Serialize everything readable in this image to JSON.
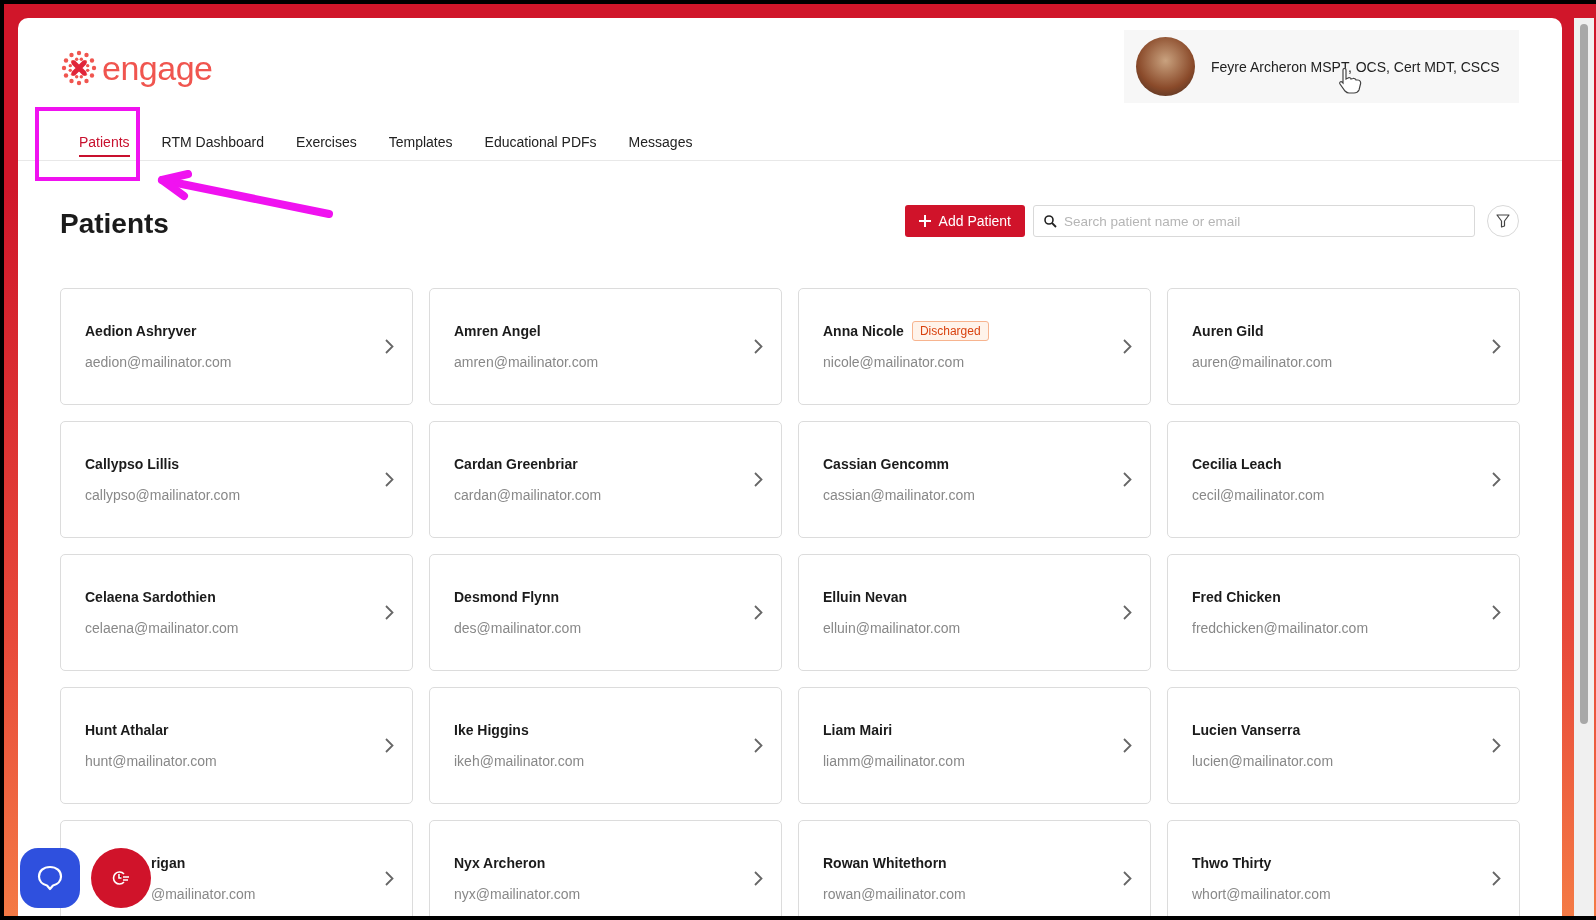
{
  "logo": {
    "text": "engage"
  },
  "user": {
    "name": "Feyre Archeron MSPT, OCS, Cert MDT, CSCS"
  },
  "tabs": [
    {
      "label": "Patients",
      "selected": true
    },
    {
      "label": "RTM Dashboard",
      "selected": false
    },
    {
      "label": "Exercises",
      "selected": false
    },
    {
      "label": "Templates",
      "selected": false
    },
    {
      "label": "Educational PDFs",
      "selected": false
    },
    {
      "label": "Messages",
      "selected": false
    }
  ],
  "page_title": "Patients",
  "add_button": {
    "label": "Add Patient"
  },
  "search": {
    "placeholder": "Search patient name or email"
  },
  "patients": [
    {
      "kind": "full",
      "name": "Aedion Ashryver",
      "email": "aedion@mailinator.com"
    },
    {
      "kind": "full",
      "name": "Amren Angel",
      "email": "amren@mailinator.com"
    },
    {
      "kind": "full",
      "name": "Anna Nicole",
      "email": "nicole@mailinator.com",
      "badge": "Discharged"
    },
    {
      "kind": "full",
      "name": "Auren Gild",
      "email": "auren@mailinator.com"
    },
    {
      "kind": "full",
      "name": "Callypso Lillis",
      "email": "callypso@mailinator.com"
    },
    {
      "kind": "full",
      "name": "Cardan Greenbriar",
      "email": "cardan@mailinator.com"
    },
    {
      "kind": "full",
      "name": "Cassian Gencomm",
      "email": "cassian@mailinator.com"
    },
    {
      "kind": "full",
      "name": "Cecilia Leach",
      "email": "cecil@mailinator.com"
    },
    {
      "kind": "full",
      "name": "Celaena Sardothien",
      "email": "celaena@mailinator.com"
    },
    {
      "kind": "full",
      "name": "Desmond Flynn",
      "email": "des@mailinator.com"
    },
    {
      "kind": "full",
      "name": "Elluin Nevan",
      "email": "elluin@mailinator.com"
    },
    {
      "kind": "full",
      "name": "Fred Chicken",
      "email": "fredchicken@mailinator.com"
    },
    {
      "kind": "full",
      "name": "Hunt Athalar",
      "email": "hunt@mailinator.com"
    },
    {
      "kind": "full",
      "name": "Ike Higgins",
      "email": "ikeh@mailinator.com"
    },
    {
      "kind": "full",
      "name": "Liam Mairi",
      "email": "liamm@mailinator.com"
    },
    {
      "kind": "full",
      "name": "Lucien Vanserra",
      "email": "lucien@mailinator.com"
    },
    {
      "kind": "partial",
      "name": "rigan",
      "email": "@mailinator.com"
    },
    {
      "kind": "full",
      "name": "Nyx Archeron",
      "email": "nyx@mailinator.com"
    },
    {
      "kind": "full",
      "name": "Rowan Whitethorn",
      "email": "rowan@mailinator.com"
    },
    {
      "kind": "full",
      "name": "Thwo Thirty",
      "email": "whort@mailinator.com"
    }
  ]
}
